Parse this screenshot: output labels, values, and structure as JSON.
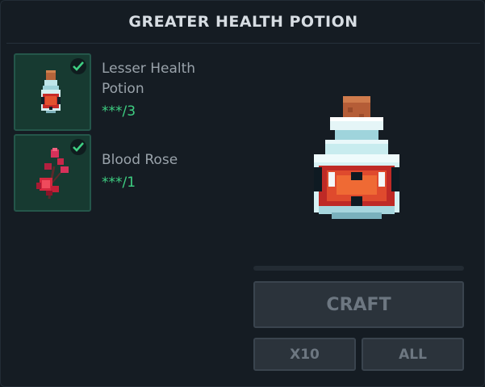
{
  "recipe": {
    "title": "GREATER HEALTH POTION",
    "ingredients": [
      {
        "name": "Lesser Health Potion",
        "count": "***/3",
        "have": true,
        "icon": "lesser-health-potion-icon"
      },
      {
        "name": "Blood Rose",
        "count": "***/1",
        "have": true,
        "icon": "blood-rose-icon"
      }
    ],
    "result_icon": "greater-health-potion-icon",
    "craft_progress": 0
  },
  "buttons": {
    "craft": "CRAFT",
    "x10": "X10",
    "all": "ALL"
  },
  "colors": {
    "have_count": "#3ecf82",
    "slot_bg": "#173a31",
    "button_disabled": "#2b333b"
  }
}
